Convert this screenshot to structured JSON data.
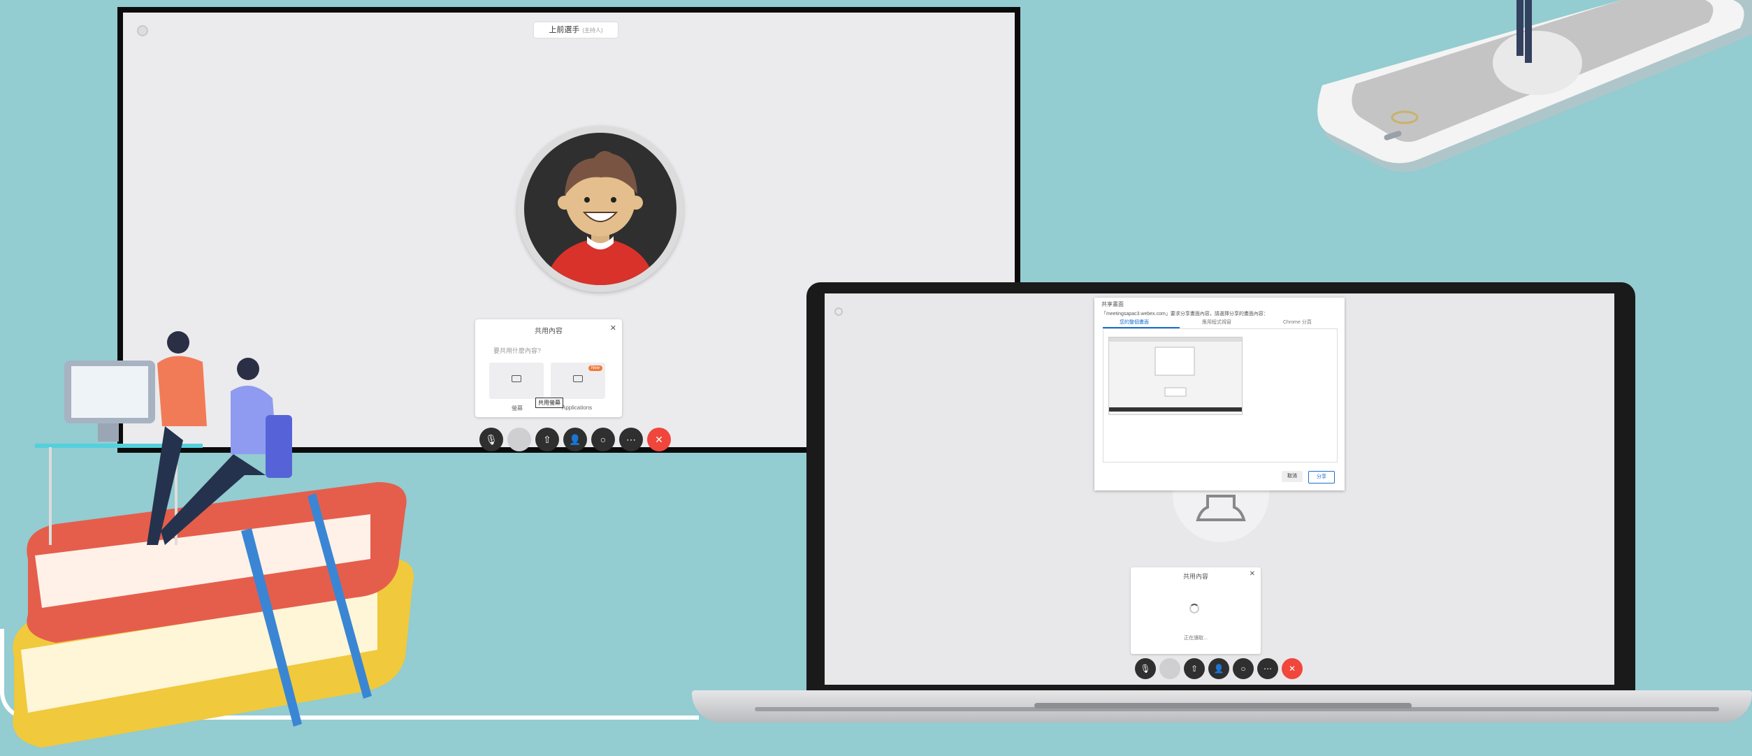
{
  "monitor": {
    "title": "上前選手",
    "title_sub": "(主持人)",
    "share_dialog": {
      "title": "共用內容",
      "question": "要共用什麼內容?",
      "options": [
        {
          "label": "螢幕",
          "icon": "monitor-icon"
        },
        {
          "label": "Applications",
          "icon": "app-window-icon",
          "badge": "New"
        }
      ],
      "tooltip": "共用螢幕"
    },
    "toolbar": [
      "mic-icon",
      "video-icon",
      "share-icon",
      "participants-icon",
      "chat-icon",
      "more-icon",
      "end-call-icon"
    ]
  },
  "laptop": {
    "screen_dialog": {
      "title": "共享畫面",
      "text": "「meetingsapac3.webex.com」要求分享畫面內容，請選擇分享的畫面內容：",
      "tabs": [
        "您的整個畫面",
        "應用程式視窗",
        "Chrome 分頁"
      ],
      "active_tab": 0,
      "cancel_label": "取消",
      "share_label": "分享"
    },
    "shared_dialog": {
      "title": "共用內容",
      "status": "正在讀取..."
    },
    "toolbar": [
      "mic-icon",
      "video-icon",
      "share-icon",
      "participants-icon",
      "chat-icon",
      "more-icon",
      "end-call-icon"
    ]
  },
  "colors": {
    "background": "#93ccd1",
    "end_call": "#f0463c",
    "accent": "#1c6fd1"
  }
}
